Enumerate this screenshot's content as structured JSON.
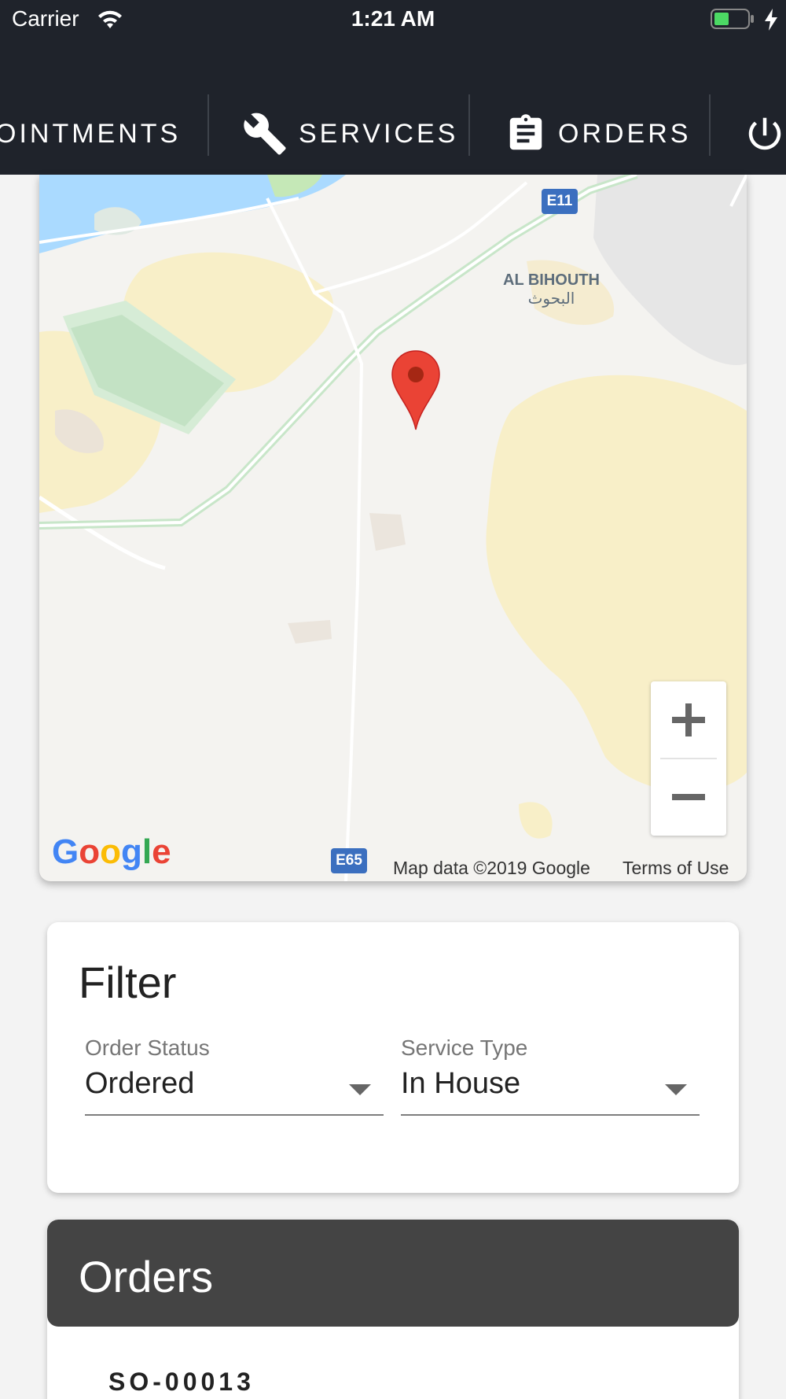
{
  "status_bar": {
    "carrier": "Carrier",
    "time": "1:21 AM",
    "icons": [
      "wifi-icon",
      "battery-icon",
      "charging-bolt-icon"
    ]
  },
  "nav": {
    "items": [
      {
        "label": "OINTMENTS",
        "icon": null
      },
      {
        "label": "SERVICES",
        "icon": "wrench-icon"
      },
      {
        "label": "ORDERS",
        "icon": "clipboard-icon"
      },
      {
        "label": "",
        "icon": "power-icon"
      }
    ]
  },
  "map": {
    "place_name": "AL BIHOUTH",
    "place_name_ar": "البحوث",
    "road_badges": [
      "E11",
      "E65"
    ],
    "attribution": "Map data ©2019 Google",
    "terms": "Terms of Use",
    "zoom_in": "+",
    "zoom_out": "−",
    "logo": "Google",
    "colors": {
      "marker": "#ea4335",
      "water": "#aadaff",
      "park": "#c8e6c9"
    }
  },
  "filter": {
    "title": "Filter",
    "order_status": {
      "label": "Order Status",
      "value": "Ordered"
    },
    "service_type": {
      "label": "Service Type",
      "value": "In House"
    }
  },
  "orders": {
    "title": "Orders",
    "items": [
      {
        "id": "SO-00013"
      }
    ]
  }
}
